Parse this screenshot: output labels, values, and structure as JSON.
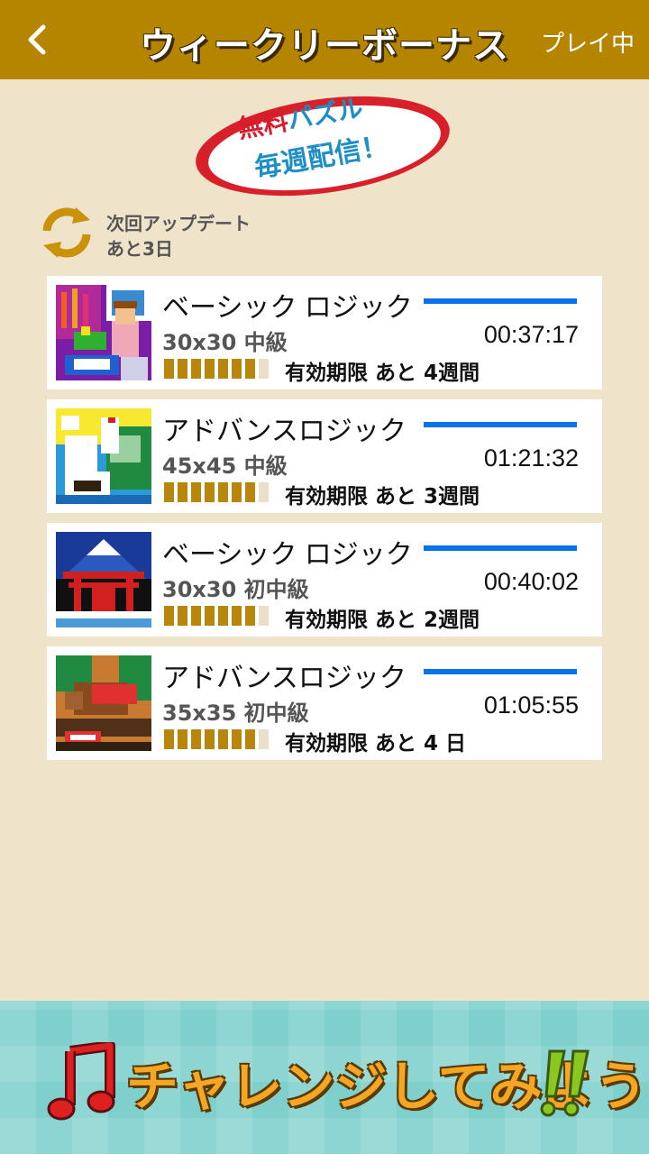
{
  "header": {
    "title": "ウィークリーボーナス",
    "status": "プレイ中"
  },
  "badge": {
    "line1_red": "無料",
    "line1_blue": "パズル",
    "line2": "毎週配信！"
  },
  "update": {
    "line1": "次回アップデート",
    "line2": "あと3日"
  },
  "puzzles": [
    {
      "title": "ベーシック ロジック",
      "size": "30x30 中級",
      "time": "00:37:17",
      "expiry": "有効期限 あと 4週間",
      "blocks_filled": 7,
      "blocks_total": 8
    },
    {
      "title": "アドバンスロジック",
      "size": "45x45 中級",
      "time": "01:21:32",
      "expiry": "有効期限 あと 3週間",
      "blocks_filled": 7,
      "blocks_total": 8
    },
    {
      "title": "ベーシック ロジック",
      "size": "30x30 初中級",
      "time": "00:40:02",
      "expiry": "有効期限 あと 2週間",
      "blocks_filled": 7,
      "blocks_total": 8
    },
    {
      "title": "アドバンスロジック",
      "size": "35x35 初中級",
      "time": "01:05:55",
      "expiry": "有効期限 あと 4 日",
      "blocks_filled": 7,
      "blocks_total": 8
    }
  ],
  "banner": {
    "text": "チャレンジしてみよう"
  },
  "colors": {
    "header": "#b58500",
    "background": "#efe3c9",
    "progress": "#0a72e8",
    "block_on": "#b8860b",
    "block_off": "#eadfc8"
  },
  "icons": {
    "back": "chevron-left-icon",
    "update": "refresh-icon",
    "banner_note": "music-note-icon",
    "banner_excl": "double-exclamation-icon"
  }
}
